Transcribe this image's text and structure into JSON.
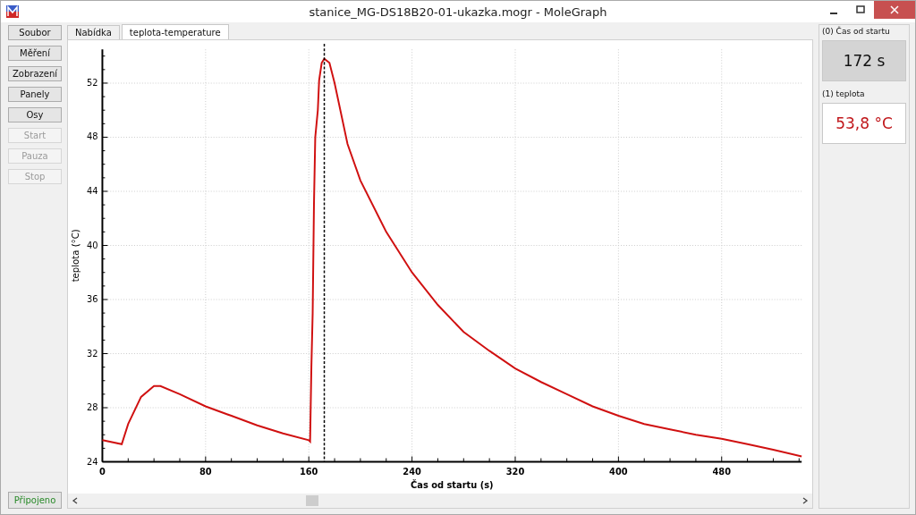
{
  "window": {
    "title": "stanice_MG-DS18B20-01-ukazka.mogr - MoleGraph"
  },
  "sidebar": {
    "buttons": [
      {
        "label": "Soubor",
        "disabled": false
      },
      {
        "label": "Měření",
        "disabled": false
      },
      {
        "label": "Zobrazení",
        "disabled": false
      },
      {
        "label": "Panely",
        "disabled": false
      },
      {
        "label": "Osy",
        "disabled": false
      },
      {
        "label": "Start",
        "disabled": true
      },
      {
        "label": "Pauza",
        "disabled": true
      },
      {
        "label": "Stop",
        "disabled": true
      }
    ],
    "status": {
      "label": "Připojeno",
      "connected": true
    }
  },
  "tabs": [
    {
      "label": "Nabídka",
      "selected": false
    },
    {
      "label": "teplota-temperature",
      "selected": true
    }
  ],
  "chart_data": {
    "type": "line",
    "xlabel": "Čas od startu (s)",
    "ylabel": "teplota (°C)",
    "x": [
      0,
      15,
      20,
      30,
      40,
      45,
      60,
      80,
      100,
      120,
      140,
      160,
      161,
      162,
      163,
      164,
      165,
      167,
      168,
      170,
      172,
      176,
      180,
      190,
      200,
      220,
      240,
      260,
      280,
      300,
      320,
      340,
      360,
      380,
      400,
      420,
      440,
      460,
      480,
      500,
      520,
      542
    ],
    "series": [
      {
        "color": "#d01010",
        "values": [
          25.6,
          25.3,
          26.8,
          28.8,
          29.6,
          29.6,
          29.0,
          28.1,
          27.4,
          26.7,
          26.1,
          25.6,
          25.5,
          31,
          35,
          43,
          48,
          50,
          52.2,
          53.5,
          53.8,
          53.5,
          52,
          47.5,
          44.8,
          41.0,
          38.0,
          35.6,
          33.6,
          32.2,
          30.9,
          29.9,
          29.0,
          28.1,
          27.4,
          26.8,
          26.4,
          26.0,
          25.7,
          25.3,
          24.9,
          24.4
        ]
      }
    ],
    "xlim": [
      0,
      542
    ],
    "ylim": [
      24,
      54.5
    ],
    "xticks": [
      0,
      80,
      160,
      240,
      320,
      400,
      480
    ],
    "yticks": [
      24,
      28,
      32,
      36,
      40,
      44,
      48,
      52
    ],
    "grid": true,
    "ref_lines": [
      {
        "axis": "x",
        "value": 172
      }
    ]
  },
  "panels": [
    {
      "label": "(0) Čas od startu",
      "value": "172 s",
      "kind": "time"
    },
    {
      "label": "(1) teplota",
      "value": "53,8 °C",
      "kind": "temperature"
    }
  ]
}
